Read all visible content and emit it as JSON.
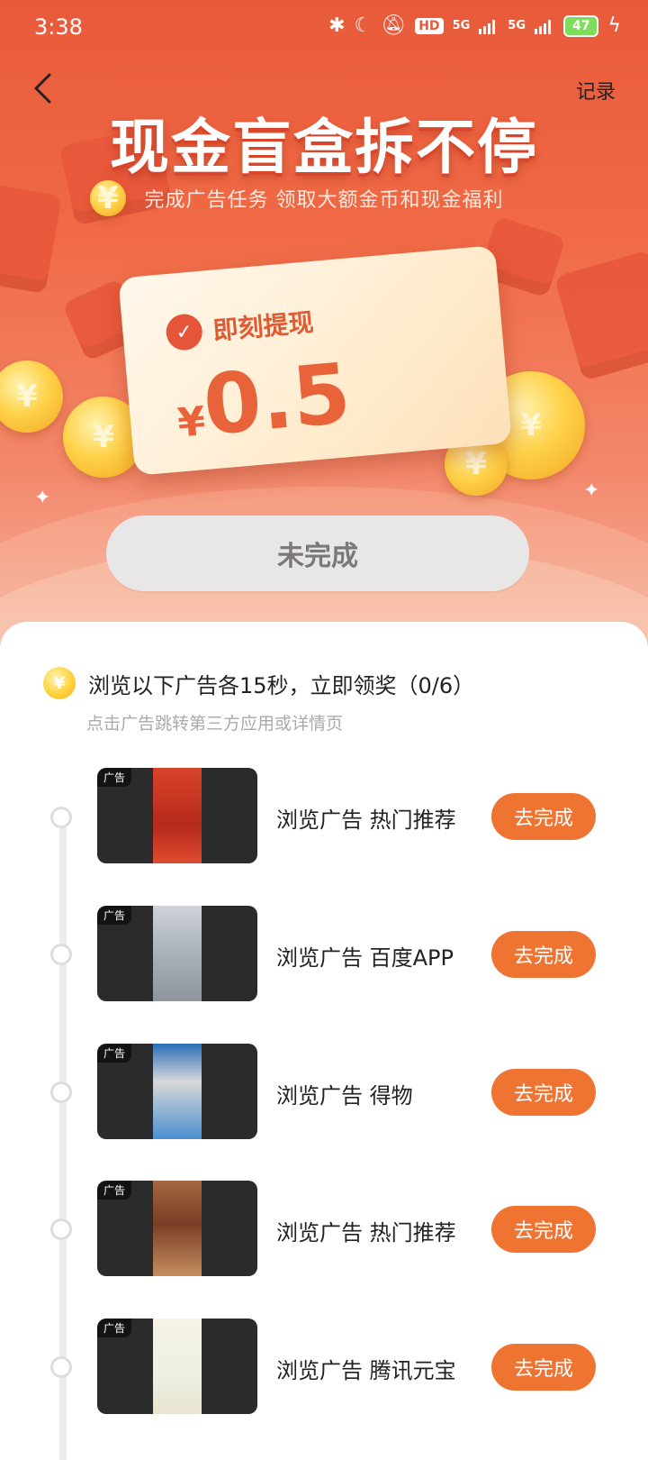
{
  "status_bar": {
    "time": "3:38",
    "hd_label": "HD",
    "network_1": "5G",
    "network_2": "5G",
    "battery": "47"
  },
  "header": {
    "title": "现金盲盒拆不停",
    "subtitle": "完成广告任务 领取大额金币和现金福利",
    "record_label": "记录"
  },
  "cash_card": {
    "label": "即刻提现",
    "currency": "¥",
    "amount": "0.5"
  },
  "status_button": "未完成",
  "tasks": {
    "title": "浏览以下广告各15秒，立即领奖（0/6）",
    "hint": "点击广告跳转第三方应用或详情页",
    "items": [
      {
        "ad_badge": "广告",
        "label": "浏览广告 热门推荐",
        "button": "去完成"
      },
      {
        "ad_badge": "广告",
        "label": "浏览广告 百度APP",
        "button": "去完成"
      },
      {
        "ad_badge": "广告",
        "label": "浏览广告 得物",
        "button": "去完成"
      },
      {
        "ad_badge": "广告",
        "label": "浏览广告 热门推荐",
        "button": "去完成"
      },
      {
        "ad_badge": "广告",
        "label": "浏览广告 腾讯元宝",
        "button": "去完成"
      }
    ]
  },
  "colors": {
    "accent": "#ef7432",
    "hero": "#e85a3a",
    "battery": "#7fdd5c"
  },
  "icons": {
    "back": "chevron-left-icon",
    "wechat_pay": "wechat-pay-icon",
    "coin": "coin-icon"
  }
}
